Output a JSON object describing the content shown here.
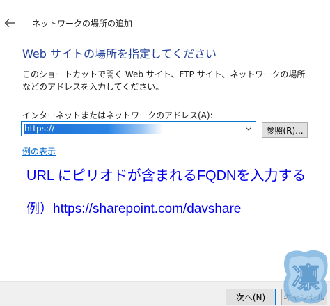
{
  "window": {
    "title": "ネットワークの場所の追加"
  },
  "main": {
    "heading": "Web サイトの場所を指定してください",
    "description": "このショートカットで開く Web サイト、FTP サイト、ネットワークの場所などのアドレスを入力してください。",
    "address_label": "インターネットまたはネットワークのアドレス(A):",
    "address_value": "https://",
    "browse_label": "参照(R)...",
    "example_link": "例の表示"
  },
  "annotations": {
    "line1": "URL にピリオドが含まれるFQDNを入力する",
    "line2": "例）https://sharepoint.com/davshare"
  },
  "footer": {
    "next_label": "次へ(N)",
    "cancel_label": "キャンセル"
  },
  "watermark": {
    "glyph": "凛"
  },
  "colors": {
    "heading": "#1f3e99",
    "annotation": "#0000ee",
    "link": "#0066cc",
    "focus": "#0078d7"
  }
}
